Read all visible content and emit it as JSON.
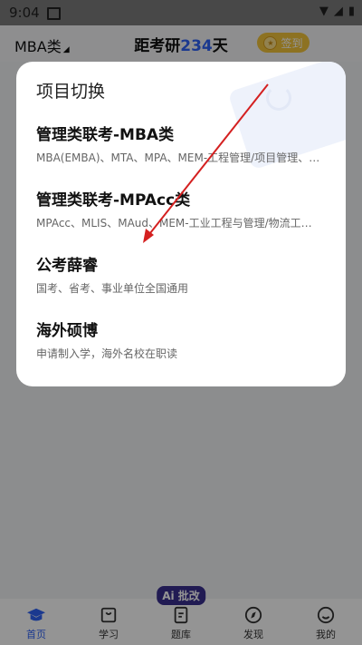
{
  "status_bar": {
    "time": "9:04"
  },
  "header": {
    "exam_category": "MBA类",
    "countdown_prefix": "距考研",
    "countdown_days": "234",
    "countdown_suffix": "天",
    "checkin_label": "签到"
  },
  "modal": {
    "title": "项目切换",
    "options": [
      {
        "title": "管理类联考-MBA类",
        "subtitle": "MBA(EMBA)、MTA、MPA、MEM-工程管理/项目管理、MPAcc..."
      },
      {
        "title": "管理类联考-MPAcc类",
        "subtitle": "MPAcc、MLIS、MAud、MEM-工业工程与管理/物流工程与管理"
      },
      {
        "title": "公考薛睿",
        "subtitle": "国考、省考、事业单位全国通用"
      },
      {
        "title": "海外硕博",
        "subtitle": "申请制入学，海外名校在职读"
      }
    ]
  },
  "bottom_nav": {
    "items": [
      {
        "label": "首页",
        "icon": "graduation-cap-icon"
      },
      {
        "label": "学习",
        "icon": "book-icon"
      },
      {
        "label": "题库",
        "icon": "document-icon"
      },
      {
        "label": "发现",
        "icon": "compass-icon"
      },
      {
        "label": "我的",
        "icon": "profile-icon"
      }
    ],
    "ai_badge": "Ai 批改"
  },
  "colors": {
    "accent": "#2f63f6",
    "checkin": "#f3c53b",
    "annotation_arrow": "#d42020"
  }
}
